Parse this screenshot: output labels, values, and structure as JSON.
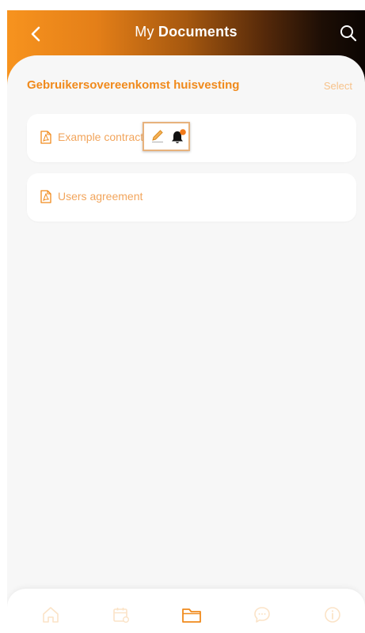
{
  "header": {
    "title_prefix": "My",
    "title_bold": "Documents",
    "back_icon": "chevron-left-icon",
    "search_icon": "search-icon"
  },
  "section": {
    "title": "Gebruikersovereenkomst huisvesting",
    "select_label": "Select"
  },
  "documents": [
    {
      "name": "Example contract",
      "icon": "pdf-icon",
      "actions": [
        "edit-icon",
        "bell-icon"
      ],
      "has_notification": true
    },
    {
      "name": "Users agreement",
      "icon": "pdf-icon"
    }
  ],
  "bottom_nav": {
    "items": [
      {
        "name": "home",
        "icon": "home-icon",
        "active": false
      },
      {
        "name": "calendar",
        "icon": "calendar-icon",
        "active": false
      },
      {
        "name": "documents",
        "icon": "folder-icon",
        "active": true
      },
      {
        "name": "messages",
        "icon": "chat-icon",
        "active": false
      },
      {
        "name": "info",
        "icon": "info-icon",
        "active": false
      }
    ]
  },
  "colors": {
    "accent": "#f08a1c",
    "header_gradient_start": "#f7931e",
    "header_gradient_end": "#0b0502",
    "nav_inactive": "#fbe3c7",
    "nav_active": "#f08a1c"
  }
}
